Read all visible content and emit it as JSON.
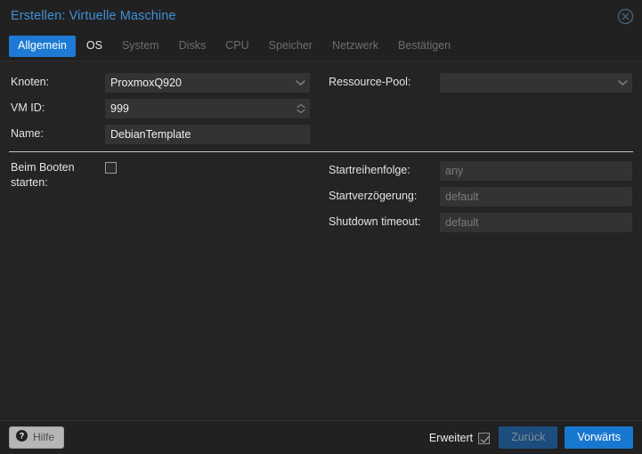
{
  "window": {
    "title": "Erstellen: Virtuelle Maschine",
    "close_icon": "close-circle-icon",
    "accent_blue": "#3e8fd8",
    "panel_bg": "#242424",
    "input_bg": "#333333",
    "active_tab_bg": "#1e7ad4",
    "primary_btn_bg": "#1878cf"
  },
  "tabs": [
    {
      "label": "Allgemein",
      "state": "active"
    },
    {
      "label": "OS",
      "state": "enabled"
    },
    {
      "label": "System",
      "state": "disabled"
    },
    {
      "label": "Disks",
      "state": "disabled"
    },
    {
      "label": "CPU",
      "state": "disabled"
    },
    {
      "label": "Speicher",
      "state": "disabled"
    },
    {
      "label": "Netzwerk",
      "state": "disabled"
    },
    {
      "label": "Bestätigen",
      "state": "disabled"
    }
  ],
  "form": {
    "left": {
      "node": {
        "label": "Knoten:",
        "value": "ProxmoxQ920",
        "placeholder": "",
        "control": "combobox",
        "icon": "chevron-down-icon"
      },
      "vmid": {
        "label": "VM ID:",
        "value": "999",
        "placeholder": "",
        "control": "spinner",
        "icon": "spinner-arrows-icon"
      },
      "name": {
        "label": "Name:",
        "value": "DebianTemplate",
        "placeholder": "",
        "control": "text"
      },
      "start_at_boot": {
        "label": "Beim Booten starten:",
        "checked": false,
        "control": "checkbox"
      }
    },
    "right": {
      "resource_pool": {
        "label": "Ressource-Pool:",
        "value": "",
        "placeholder": "",
        "control": "combobox",
        "icon": "chevron-down-icon"
      },
      "start_order": {
        "label": "Startreihenfolge:",
        "value": "",
        "placeholder": "any",
        "control": "text"
      },
      "startup_delay": {
        "label": "Startverzögerung:",
        "value": "",
        "placeholder": "default",
        "control": "text"
      },
      "shutdown_timeout": {
        "label": "Shutdown timeout:",
        "value": "",
        "placeholder": "default",
        "control": "text"
      }
    }
  },
  "footer": {
    "help_label": "Hilfe",
    "help_icon": "question-mark-icon",
    "advanced_label": "Erweitert",
    "advanced_checked": true,
    "back_label": "Zurück",
    "back_disabled": true,
    "next_label": "Vorwärts"
  }
}
